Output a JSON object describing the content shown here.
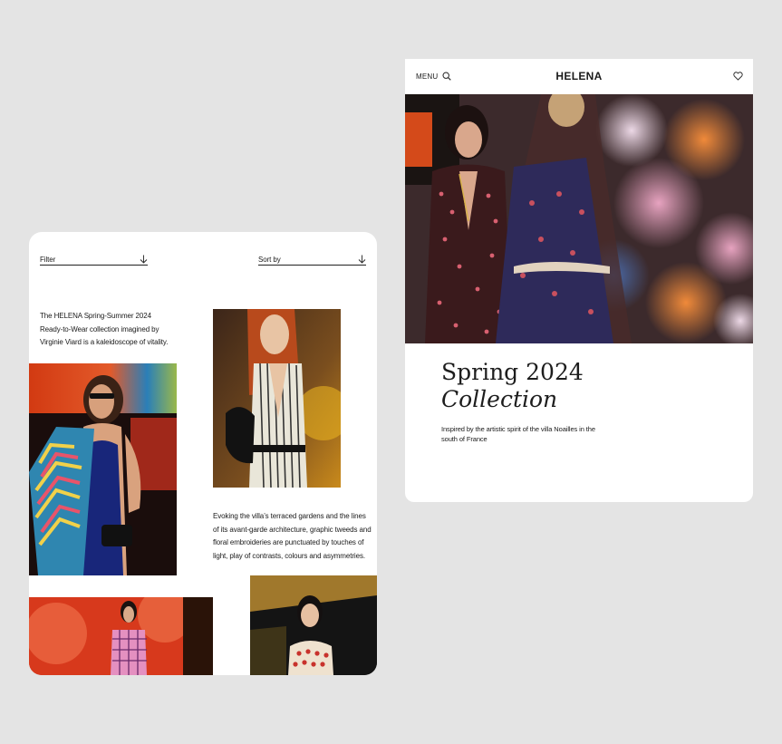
{
  "listing": {
    "filter_label": "Filter",
    "sort_label": "Sort by",
    "intro_text": "The HELENA Spring-Summer 2024 Ready-to-Wear collection imagined by Virginie Viard is a kaleidoscope of vitality.",
    "body_text": "Evoking the villa’s terraced gardens and the lines of its avant-garde architecture, graphic tweeds and floral embroideries are punctuated by touches of light, play of contrasts, colours and asymmetries."
  },
  "hero": {
    "menu_label": "MENU",
    "brand": "HELENA",
    "title_line1": "Spring 2024",
    "title_line2": "Collection",
    "subtitle": "Inspired by the artistic spirit of the villa Noailles in the south of France"
  },
  "icons": {
    "filter": "arrow-down-icon",
    "sort": "arrow-down-icon",
    "search": "search-icon",
    "wishlist": "heart-icon"
  },
  "colors": {
    "page_background": "#e4e4e4",
    "card_background": "#ffffff",
    "text": "#1a1a1a"
  }
}
